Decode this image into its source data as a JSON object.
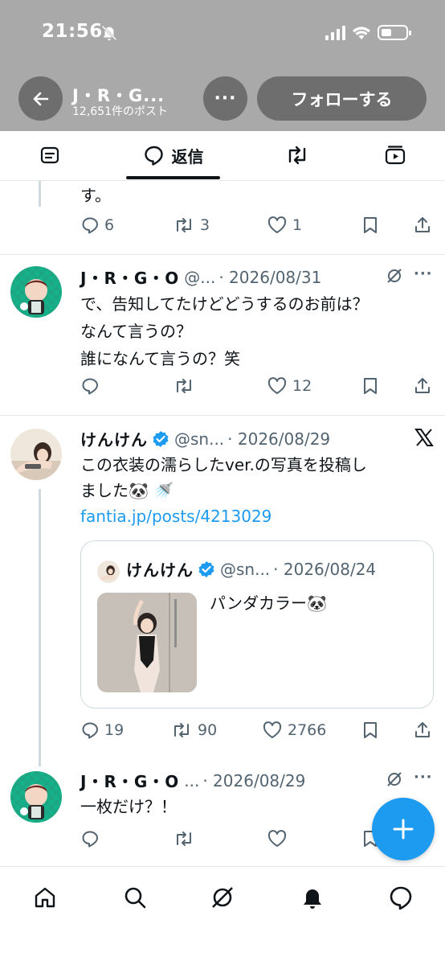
{
  "status_bar": {
    "time": "21:56"
  },
  "header": {
    "account_name": "J・R・G...",
    "post_count": "12,651件のポスト",
    "more_label": "···",
    "follow_label": "フォローする"
  },
  "tabs": {
    "active_label": "返信"
  },
  "tweets": [
    {
      "text_lines": [
        "す。"
      ],
      "replies": "6",
      "retweets": "3",
      "likes": "1"
    },
    {
      "name": "J・R・G・O",
      "handle": "@...",
      "date": "· 2026/08/31",
      "text_lines": [
        "で、告知してたけどどうするのお前は？",
        "なんて言うの？",
        "誰になんて言うの？笑"
      ],
      "replies": "",
      "retweets": "",
      "likes": "12"
    },
    {
      "name": "けんけん",
      "handle": "@sn...",
      "date": "· 2026/08/29",
      "text_lines": [
        "この衣装の濡らしたver.の写真を投稿し",
        "ました🐼 🚿"
      ],
      "link": "fantia.jp/posts/4213029",
      "replies": "19",
      "retweets": "90",
      "likes": "2766",
      "quote": {
        "name": "けんけん",
        "handle": "@sn...",
        "date": "· 2026/08/24",
        "text": "パンダカラー🐼"
      }
    },
    {
      "name": "J・R・G・O",
      "handle": "...",
      "date": "· 2026/08/29",
      "text_lines": [
        "一枚だけ？！"
      ]
    }
  ],
  "colors": {
    "accent": "#1d9bf0",
    "verified": "#1d9bf0",
    "header_overlay": "#a9a9a9",
    "muted": "#536471"
  }
}
